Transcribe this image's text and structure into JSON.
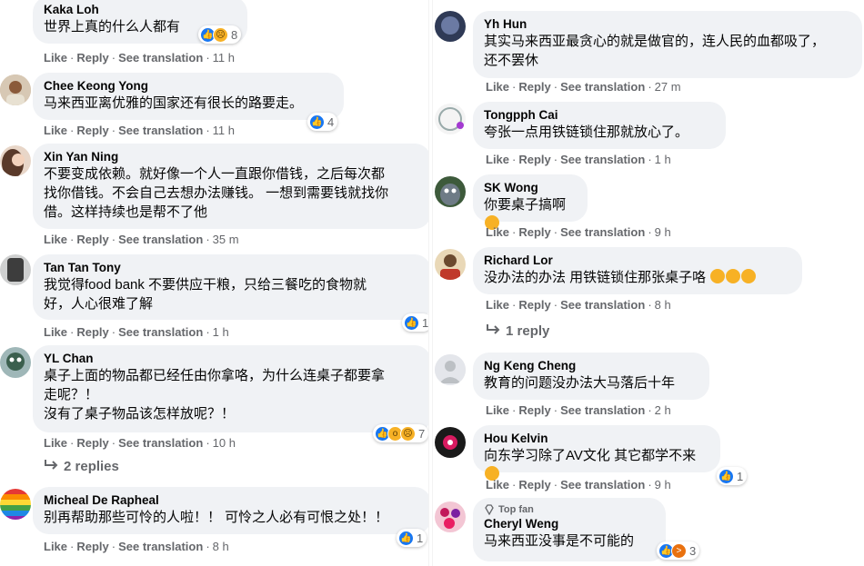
{
  "actions": {
    "like": "Like",
    "reply": "Reply",
    "translate": "See translation"
  },
  "left": [
    {
      "name": "Kaka Loh",
      "text": "世界上真的什么人都有",
      "time": "11 h",
      "reactions": [
        "like",
        "sad"
      ],
      "count": "8"
    },
    {
      "name": "Chee Keong Yong",
      "text": "马来西亚离优雅的国家还有很长的路要走。",
      "time": "11 h",
      "reactions": [
        "like"
      ],
      "count": "4"
    },
    {
      "name": "Xin Yan Ning",
      "text": "不要变成依赖。就好像一个人一直跟你借钱，之后每次都\n找你借钱。不会自己去想办法赚钱。 一想到需要钱就找你\n借。这样持续也是帮不了他",
      "time": "35 m"
    },
    {
      "name": "Tan Tan Tony",
      "text": "我觉得food bank 不要供应干粮，只给三餐吃的食物就\n好，人心很难了解",
      "time": "1 h",
      "reactions": [
        "like"
      ],
      "count": "1"
    },
    {
      "name": "YL Chan",
      "text": "桌子上面的物品都已经任由你拿咯，为什么连桌子都要拿\n走呢？！\n沒有了桌子物品该怎样放呢？！",
      "time": "10 h",
      "reactions": [
        "like",
        "wow",
        "sad"
      ],
      "count": "7",
      "replies": "2 replies"
    },
    {
      "name": "Micheal De Rapheal",
      "text": "别再帮助那些可怜的人啦！！ 可怜之人必有可恨之处！！",
      "time": "8 h",
      "reactions": [
        "like"
      ],
      "count": "1"
    }
  ],
  "right": [
    {
      "name": "Yh Hun",
      "text": "其实马来西亚最贪心的就是做官的，连人民的血都吸了，\n还不罢休",
      "time": "27 m"
    },
    {
      "name": "Tongpph Cai",
      "text": "夸张一点用铁链锁住那就放心了。",
      "time": "1 h"
    },
    {
      "name": "SK Wong",
      "text": "你要桌子搞啊",
      "time": "9 h"
    },
    {
      "name": "Richard Lor",
      "text": "没办法的办法 用铁链锁住那张桌子咯",
      "time": "8 h",
      "replies": "1 reply"
    },
    {
      "name": "Ng Keng Cheng",
      "text": "教育的问题没办法大马落后十年",
      "time": "2 h"
    },
    {
      "name": "Hou Kelvin",
      "text": "向东学习除了AV文化 其它都学不来",
      "time": "9 h",
      "reactions": [
        "like"
      ],
      "count": "1"
    },
    {
      "name": "Cheryl Weng",
      "badge": "Top fan",
      "text": "马来西亚没事是不可能的",
      "reactions": [
        "like",
        "angry"
      ],
      "count": "3"
    }
  ],
  "colors": {
    "bubble": "#f0f2f5",
    "meta": "#65676b",
    "like": "#1877f2"
  }
}
